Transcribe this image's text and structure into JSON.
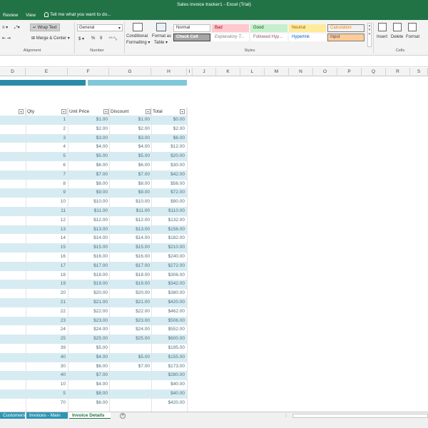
{
  "window": {
    "title": "Sales invoice tracker1 - Excel (Trial)"
  },
  "menu": {
    "items": [
      "Review",
      "View"
    ],
    "tell_me": "Tell me what you want to do..."
  },
  "ribbon": {
    "wrap_text": "Wrap Text",
    "merge_center": "Merge & Center",
    "number_format": "General",
    "number_symbols": [
      "$",
      "%",
      "9"
    ],
    "conditional_formatting": [
      "Conditional",
      "Formatting"
    ],
    "format_as_table": [
      "Format as",
      "Table"
    ],
    "styles": [
      {
        "label": "Normal",
        "bg": "#ffffff",
        "fg": "#333333",
        "border": "#bdbdbd"
      },
      {
        "label": "Bad",
        "bg": "#ffc7ce",
        "fg": "#9c0006",
        "border": "#ffc7ce"
      },
      {
        "label": "Good",
        "bg": "#c6efce",
        "fg": "#006100",
        "border": "#c6efce"
      },
      {
        "label": "Neutral",
        "bg": "#ffeb9c",
        "fg": "#9c6500",
        "border": "#ffeb9c"
      },
      {
        "label": "Calculation",
        "bg": "#f2f2f2",
        "fg": "#fa7d00",
        "border": "#7f7f7f"
      },
      {
        "label": "Check Cell",
        "bg": "#a5a5a5",
        "fg": "#ffffff",
        "border": "#3f3f3f"
      },
      {
        "label": "Explanatory T...",
        "bg": "#ffffff",
        "fg": "#7f7f7f",
        "border": "#ffffff"
      },
      {
        "label": "Followed Hyp...",
        "bg": "#ffffff",
        "fg": "#954f72",
        "border": "#ffffff"
      },
      {
        "label": "Hyperlink",
        "bg": "#ffffff",
        "fg": "#0563c1",
        "border": "#ffffff"
      },
      {
        "label": "Input",
        "bg": "#ffcc99",
        "fg": "#3f3f76",
        "border": "#7f7f7f"
      }
    ],
    "cells": [
      "Insert",
      "Delete",
      "Format"
    ],
    "group_labels": {
      "alignment": "Alignment",
      "number": "Number",
      "styles": "Styles",
      "cells": "Cells"
    }
  },
  "columns": [
    "D",
    "E",
    "F",
    "G",
    "H",
    "I",
    "J",
    "K",
    "L",
    "M",
    "N",
    "O",
    "P",
    "Q",
    "R",
    "S"
  ],
  "table": {
    "headers": [
      "Qty",
      "Unit Price",
      "Discount",
      "Total"
    ],
    "rows": [
      {
        "qty": "1",
        "price": "$1.00",
        "discount": "$1.00",
        "total": "$0.00"
      },
      {
        "qty": "2",
        "price": "$2.00",
        "discount": "$2.00",
        "total": "$2.00"
      },
      {
        "qty": "3",
        "price": "$3.00",
        "discount": "$3.00",
        "total": "$6.00"
      },
      {
        "qty": "4",
        "price": "$4.00",
        "discount": "$4.00",
        "total": "$12.00"
      },
      {
        "qty": "5",
        "price": "$5.00",
        "discount": "$5.00",
        "total": "$20.00"
      },
      {
        "qty": "6",
        "price": "$6.00",
        "discount": "$6.00",
        "total": "$30.00"
      },
      {
        "qty": "7",
        "price": "$7.00",
        "discount": "$7.00",
        "total": "$42.00"
      },
      {
        "qty": "8",
        "price": "$8.00",
        "discount": "$8.00",
        "total": "$56.00"
      },
      {
        "qty": "9",
        "price": "$9.00",
        "discount": "$9.00",
        "total": "$72.00"
      },
      {
        "qty": "10",
        "price": "$10.00",
        "discount": "$10.00",
        "total": "$90.00"
      },
      {
        "qty": "11",
        "price": "$11.00",
        "discount": "$11.00",
        "total": "$110.00"
      },
      {
        "qty": "12",
        "price": "$12.00",
        "discount": "$12.00",
        "total": "$132.00"
      },
      {
        "qty": "13",
        "price": "$13.00",
        "discount": "$13.00",
        "total": "$156.00"
      },
      {
        "qty": "14",
        "price": "$14.00",
        "discount": "$14.00",
        "total": "$182.00"
      },
      {
        "qty": "15",
        "price": "$15.00",
        "discount": "$15.00",
        "total": "$210.00"
      },
      {
        "qty": "16",
        "price": "$16.00",
        "discount": "$16.00",
        "total": "$240.00"
      },
      {
        "qty": "17",
        "price": "$17.00",
        "discount": "$17.00",
        "total": "$272.00"
      },
      {
        "qty": "18",
        "price": "$18.00",
        "discount": "$18.00",
        "total": "$306.00"
      },
      {
        "qty": "19",
        "price": "$19.00",
        "discount": "$19.00",
        "total": "$342.00"
      },
      {
        "qty": "20",
        "price": "$20.00",
        "discount": "$20.00",
        "total": "$380.00"
      },
      {
        "qty": "21",
        "price": "$21.00",
        "discount": "$21.00",
        "total": "$420.00"
      },
      {
        "qty": "22",
        "price": "$22.00",
        "discount": "$22.00",
        "total": "$462.00"
      },
      {
        "qty": "23",
        "price": "$23.00",
        "discount": "$23.00",
        "total": "$506.00"
      },
      {
        "qty": "24",
        "price": "$24.00",
        "discount": "$24.00",
        "total": "$552.00"
      },
      {
        "qty": "25",
        "price": "$25.00",
        "discount": "$25.00",
        "total": "$600.00"
      },
      {
        "qty": "39",
        "price": "$5.00",
        "discount": "",
        "total": "$195.00"
      },
      {
        "qty": "40",
        "price": "$4.00",
        "discount": "$5.00",
        "total": "$155.00"
      },
      {
        "qty": "30",
        "price": "$6.00",
        "discount": "$7.00",
        "total": "$173.00"
      },
      {
        "qty": "40",
        "price": "$7.00",
        "discount": "",
        "total": "$280.00"
      },
      {
        "qty": "10",
        "price": "$4.00",
        "discount": "",
        "total": "$40.00"
      },
      {
        "qty": "5",
        "price": "$8.00",
        "discount": "",
        "total": "$40.00"
      },
      {
        "qty": "70",
        "price": "$6.00",
        "discount": "",
        "total": "$420.00"
      }
    ]
  },
  "sheet_tabs": [
    "Customers",
    "Invoices - Main",
    "Invoice Details"
  ],
  "colors": {
    "excel_green": "#217346",
    "accent_dark": "#2a8ca8",
    "accent_light": "#7fc7d9",
    "band": "#d7ecf2"
  }
}
